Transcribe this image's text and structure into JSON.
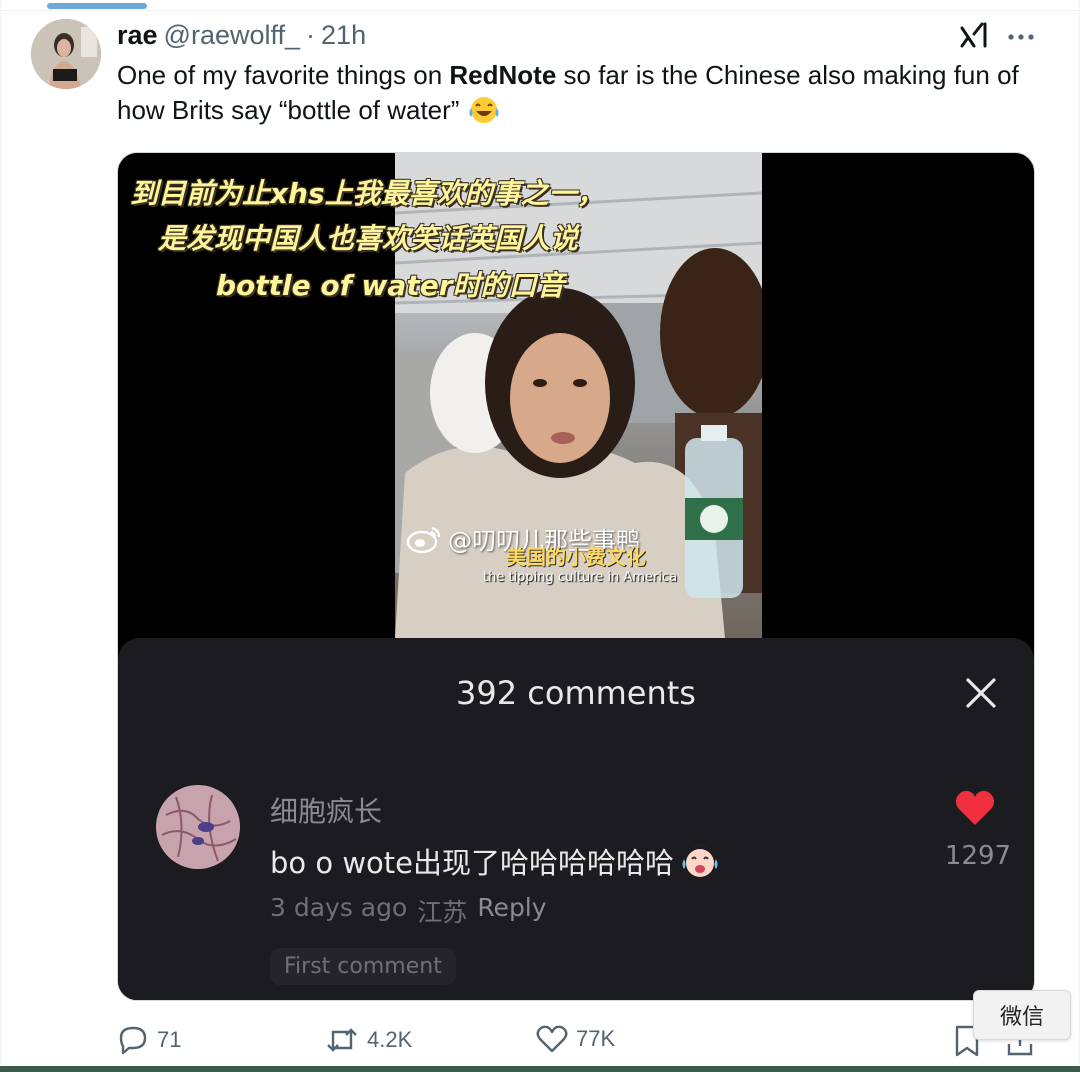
{
  "tweet": {
    "display_name": "rae",
    "handle": "@raewolff_",
    "separator": "·",
    "time": "21h",
    "text_before": "One of my favorite things on ",
    "text_bold": "RedNote",
    "text_after": " so far is the Chinese also making fun of how Brits say “bottle of water”",
    "emoji": "face-with-tears-of-joy"
  },
  "video": {
    "caption_line1": "到目前为止xhs上我最喜欢的事之一，",
    "caption_line2": "是发现中国人也喜欢笑话英国人说",
    "caption_line3": "bottle of water时的口音",
    "watermark": "@叨叨儿那些事鸭",
    "subtitle_cn": "美国的小费文化",
    "subtitle_en": "the tipping culture in America"
  },
  "comments": {
    "title": "392 comments",
    "comment": {
      "username": "细胞疯长",
      "text": "bo o wote出现了哈哈哈哈哈哈",
      "time": "3 days ago",
      "location": "江苏",
      "reply_label": "Reply",
      "likes": "1297"
    },
    "first_comment_tag": "First comment"
  },
  "actions": {
    "replies": "71",
    "reposts": "4.2K",
    "likes": "77K"
  },
  "tooltip": {
    "label": "微信"
  },
  "icons": {
    "grok": "grok-icon",
    "more": "more-icon",
    "close": "close-icon",
    "heart": "heart-icon",
    "reply": "reply-icon",
    "repost": "repost-icon",
    "like": "like-icon",
    "bookmark": "bookmark-icon",
    "share": "share-icon",
    "weibo": "weibo-icon"
  },
  "colors": {
    "text_primary": "#0f1419",
    "text_secondary": "#536471",
    "caption_yellow": "#fff59a",
    "panel_bg": "#1b1b20",
    "heart_red": "#f0303f"
  }
}
